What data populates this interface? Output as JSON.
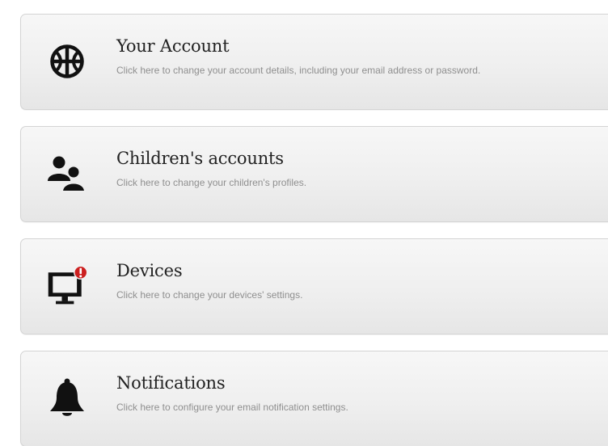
{
  "cards": [
    {
      "icon": "globe-icon",
      "title": "Your Account",
      "description": "Click here to change your account details, including your email address or password."
    },
    {
      "icon": "users-icon",
      "title": "Children's accounts",
      "description": "Click here to change your children's profiles."
    },
    {
      "icon": "monitor-alert-icon",
      "title": "Devices",
      "description": "Click here to change your devices' settings.",
      "badge": "!"
    },
    {
      "icon": "bell-icon",
      "title": "Notifications",
      "description": "Click here to configure your email notification settings."
    }
  ],
  "colors": {
    "icon": "#111111",
    "badge": "#cc1f1f",
    "title": "#222222",
    "description": "#8f8f8f",
    "card_border": "#d4d4d4"
  }
}
